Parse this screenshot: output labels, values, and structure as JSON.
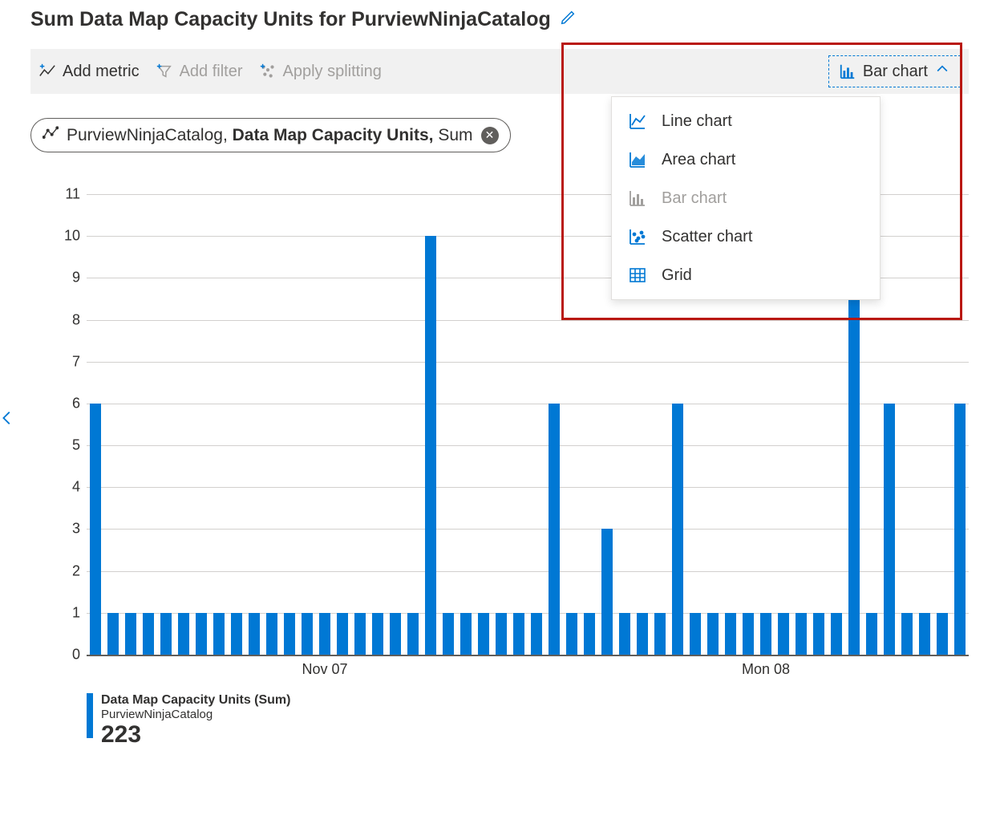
{
  "title": "Sum Data Map Capacity Units for PurviewNinjaCatalog",
  "toolbar": {
    "add_metric": "Add metric",
    "add_filter": "Add filter",
    "apply_splitting": "Apply splitting",
    "chart_type": "Bar chart"
  },
  "chart_menu": {
    "line": "Line chart",
    "area": "Area chart",
    "bar": "Bar chart",
    "scatter": "Scatter chart",
    "grid": "Grid"
  },
  "chip": {
    "resource": "PurviewNinjaCatalog",
    "metric": "Data Map Capacity Units,",
    "agg": "Sum"
  },
  "legend": {
    "line1": "Data Map Capacity Units (Sum)",
    "line2": "PurviewNinjaCatalog",
    "value": "223"
  },
  "colors": {
    "accent": "#0078d4",
    "highlight": "#b91811"
  },
  "chart_data": {
    "type": "bar",
    "title": "Sum Data Map Capacity Units for PurviewNinjaCatalog",
    "ylabel": "",
    "xlabel": "",
    "ylim": [
      0,
      11.5
    ],
    "yticks": [
      0,
      1,
      2,
      3,
      4,
      5,
      6,
      7,
      8,
      9,
      10,
      11
    ],
    "xticks": [
      {
        "index": 13,
        "label": "Nov 07"
      },
      {
        "index": 38,
        "label": "Mon 08"
      }
    ],
    "values": [
      6,
      1,
      1,
      1,
      1,
      1,
      1,
      1,
      1,
      1,
      1,
      1,
      1,
      1,
      1,
      1,
      1,
      1,
      1,
      10,
      1,
      1,
      1,
      1,
      1,
      1,
      6,
      1,
      1,
      3,
      1,
      1,
      1,
      6,
      1,
      1,
      1,
      1,
      1,
      1,
      1,
      1,
      1,
      9,
      1,
      6,
      1,
      1,
      1,
      6
    ]
  }
}
